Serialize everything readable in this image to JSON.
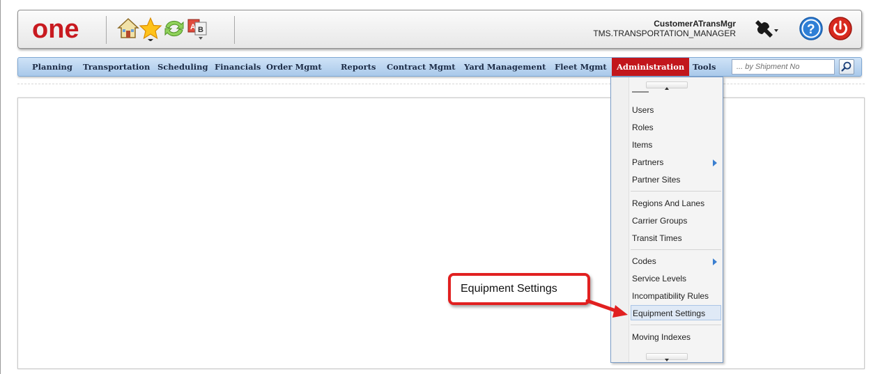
{
  "header": {
    "logo_text": "one",
    "user": {
      "name": "CustomerATransMgr",
      "role": "TMS.TRANSPORTATION_MANAGER"
    },
    "icons": [
      "home-icon",
      "favorites-star-icon",
      "refresh-icon",
      "language-ab-icon",
      "tools-wrench-icon",
      "help-icon",
      "power-icon"
    ]
  },
  "nav": {
    "items": [
      {
        "label": "Planning"
      },
      {
        "label": "Transportation"
      },
      {
        "label": "Scheduling"
      },
      {
        "label": "Financials"
      },
      {
        "label": "Order Mgmt"
      },
      {
        "label": "Reports"
      },
      {
        "label": "Contract Mgmt"
      },
      {
        "label": "Yard Management"
      },
      {
        "label": "Fleet Mgmt"
      },
      {
        "label": "Administration",
        "active": true
      },
      {
        "label": "Tools"
      }
    ],
    "search_placeholder": "... by Shipment No"
  },
  "menu": {
    "items": [
      {
        "label": "Users"
      },
      {
        "label": "Roles"
      },
      {
        "label": "Items"
      },
      {
        "label": "Partners",
        "submenu": true
      },
      {
        "label": "Partner Sites"
      },
      {
        "label": "Regions And Lanes"
      },
      {
        "label": "Carrier Groups"
      },
      {
        "label": "Transit Times"
      },
      {
        "label": "Codes",
        "submenu": true
      },
      {
        "label": "Service Levels"
      },
      {
        "label": "Incompatibility Rules"
      },
      {
        "label": "Equipment Settings",
        "highlighted": true
      },
      {
        "label": "Moving Indexes"
      }
    ]
  },
  "callout": {
    "text": "Equipment Settings"
  },
  "colors": {
    "accent": "#c2161c",
    "nav_bg": "#b7d2ee",
    "callout_border": "#e12020"
  }
}
